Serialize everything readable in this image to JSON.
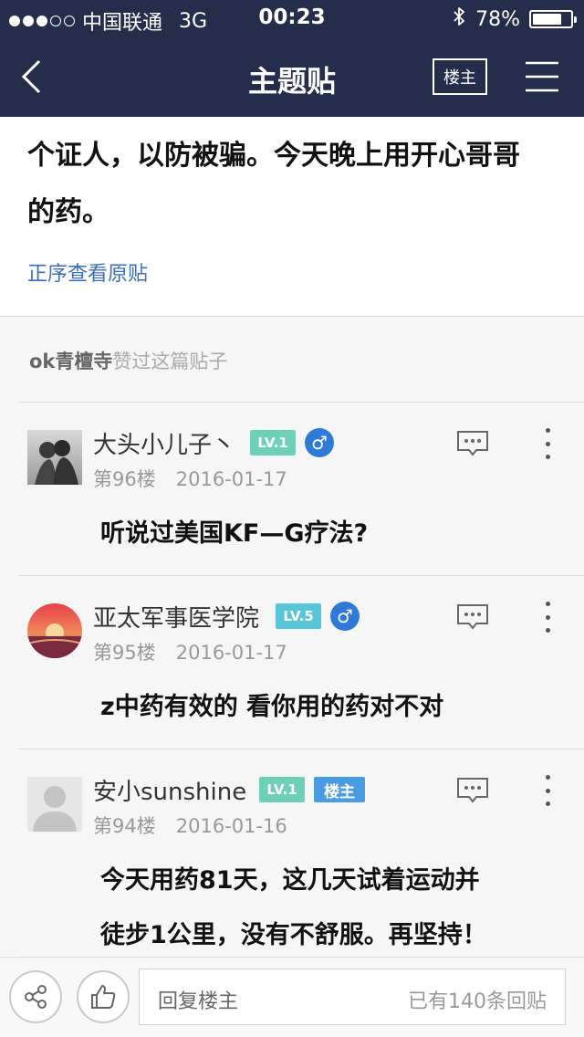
{
  "status_bar": {
    "signal_dots_filled": 3,
    "signal_dots_total": 5,
    "carrier": "中国联通",
    "network": "3G",
    "time": "00:23",
    "battery_percent": "78%",
    "battery_level": 0.78
  },
  "nav": {
    "title": "主题贴",
    "louzhu_button": "楼主"
  },
  "post": {
    "body_line1": "个证人，以防被骗。今天晚上用开心哥哥",
    "body_line2": "的药。",
    "original_link": "正序查看原贴"
  },
  "likes": {
    "liker": "ok青檀寺",
    "text": "赞过这篇贴子"
  },
  "comments": [
    {
      "username": "大头小儿子丶",
      "level": "LV.1",
      "gender": "♂",
      "floor": "第96楼",
      "date": "2016-01-17",
      "text": "听说过美国KF—G疗法?"
    },
    {
      "username": "亚太军事医学院",
      "level": "LV.5",
      "gender": "♂",
      "floor": "第95楼",
      "date": "2016-01-17",
      "text": "z中药有效的 看你用的药对不对"
    },
    {
      "username": "安小sunshine",
      "level": "LV.1",
      "badge": "楼主",
      "floor": "第94楼",
      "date": "2016-01-16",
      "text_line1": "今天用药81天，这几天试着运动并",
      "text_line2": "徒步1公里，没有不舒服。再坚持！"
    }
  ],
  "bottom_bar": {
    "reply_placeholder": "回复楼主",
    "reply_count": "已有140条回贴"
  },
  "icons": [
    "back-arrow-icon",
    "menu-icon",
    "reply-bubble-icon",
    "more-vertical-icon",
    "share-icon",
    "thumbs-up-icon",
    "male-icon",
    "bluetooth-icon",
    "battery-icon"
  ],
  "colors": {
    "header_bg": "#262d4a",
    "link": "#3a6fb8",
    "level_badge": "#6fd0b8",
    "louzhu_badge": "#4a9ce0",
    "gender_badge": "#2e7ad6"
  }
}
